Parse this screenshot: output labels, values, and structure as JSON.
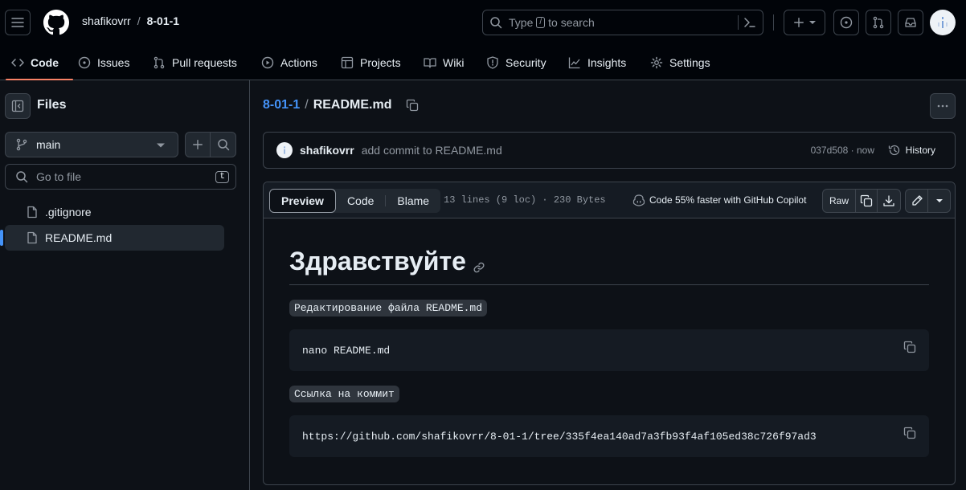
{
  "header": {
    "owner": "shafikovrr",
    "separator": "/",
    "repo": "8-01-1",
    "search_prefix": "Type",
    "search_key": "/",
    "search_suffix": "to search"
  },
  "nav": {
    "tabs": [
      {
        "label": "Code",
        "icon": "code-icon",
        "active": true
      },
      {
        "label": "Issues",
        "icon": "issue-icon"
      },
      {
        "label": "Pull requests",
        "icon": "pull-request-icon"
      },
      {
        "label": "Actions",
        "icon": "play-icon"
      },
      {
        "label": "Projects",
        "icon": "table-icon"
      },
      {
        "label": "Wiki",
        "icon": "book-icon"
      },
      {
        "label": "Security",
        "icon": "shield-icon"
      },
      {
        "label": "Insights",
        "icon": "graph-icon"
      },
      {
        "label": "Settings",
        "icon": "gear-icon"
      }
    ]
  },
  "sidebar": {
    "title": "Files",
    "branch": "main",
    "goto_placeholder": "Go to file",
    "goto_key": "t",
    "files": [
      {
        "name": ".gitignore"
      },
      {
        "name": "README.md",
        "active": true
      }
    ]
  },
  "path": {
    "repo": "8-01-1",
    "separator": "/",
    "file": "README.md"
  },
  "commit": {
    "author": "shafikovrr",
    "message": "add commit to README.md",
    "sha": "037d508",
    "dot": "·",
    "time": "now",
    "history_label": "History"
  },
  "file_header": {
    "tab_preview": "Preview",
    "tab_code": "Code",
    "tab_blame": "Blame",
    "info": "13 lines (9 loc) · 230 Bytes",
    "copilot": "Code 55% faster with GitHub Copilot",
    "raw": "Raw"
  },
  "readme": {
    "heading": "Здравствуйте",
    "inline1": "Редактирование файла README.md",
    "code1": "nano README.md",
    "inline2": "Ссылка на коммит",
    "code2": "https://github.com/shafikovrr/8-01-1/tree/335f4ea140ad7a3fb93f4af105ed38c726f97ad3"
  },
  "colors": {
    "background": "#0d1117",
    "accent_link": "#4493f8",
    "active_tab_underline": "#f78166"
  }
}
